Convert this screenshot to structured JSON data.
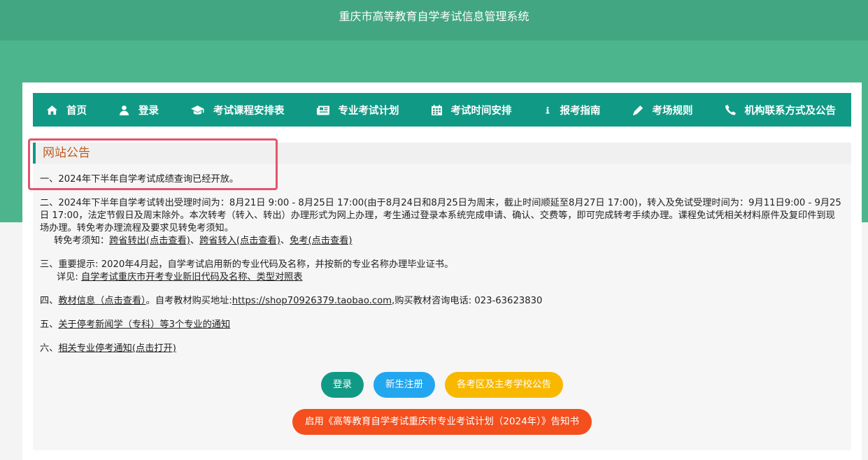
{
  "header": {
    "title": "重庆市高等教育自学考试信息管理系统"
  },
  "nav": {
    "items": [
      {
        "label": "首页",
        "icon": "home-icon"
      },
      {
        "label": "登录",
        "icon": "user-icon"
      },
      {
        "label": "考试课程安排表",
        "icon": "graduation-cap-icon"
      },
      {
        "label": "专业考试计划",
        "icon": "newspaper-icon"
      },
      {
        "label": "考试时间安排",
        "icon": "calendar-icon"
      },
      {
        "label": "报考指南",
        "icon": "info-icon"
      },
      {
        "label": "考场规则",
        "icon": "pencil-icon"
      },
      {
        "label": "机构联系方式及公告",
        "icon": "phone-icon"
      }
    ]
  },
  "notice": {
    "title": "网站公告",
    "item1": "一、2024年下半年自学考试成绩查询已经开放。",
    "item2": "二、2024年下半年自学考试转出受理时间为：8月21日 9:00 - 8月25日 17:00(由于8月24日和8月25日为周末，截止时间顺延至8月27日 17:00)，转入及免试受理时间为：9月11日9:00 - 9月25日 17:00，法定节假日及周末除外。本次转考（转入、转出）办理形式为网上办理，考生通过登录本系统完成申请、确认、交费等，即可完成转考手续办理。课程免试凭相关材料原件及复印件到现场办理。转免考办理流程及要求见转免考须知。",
    "item2_sub_label": "转免考须知：",
    "item2_links": [
      "跨省转出(点击查看)",
      "跨省转入(点击查看)",
      "免考(点击查看)"
    ],
    "item2_sep": "、",
    "item3": "三、重要提示: 2020年4月起，自学考试启用新的专业代码及名称，并按新的专业名称办理毕业证书。",
    "item3_sub_label": "详见: ",
    "item3_link": "自学考试重庆市开考专业新旧代码及名称、类型对照表",
    "item4_prefix": "四、",
    "item4_link": "教材信息（点击查看）",
    "item4_mid": "。自考教材购买地址:",
    "item4_url": "https://shop70926379.taobao.com",
    "item4_suffix": ",购买教材咨询电话:  023-63623830",
    "item5_prefix": "五、",
    "item5_link": "关于停考新闻学（专科）等3个专业的通知",
    "item6_prefix": "六、",
    "item6_link": "相关专业停考通知(点击打开)"
  },
  "buttons": {
    "login": "登录",
    "register": "新生注册",
    "announcements": "各考区及主考学校公告",
    "plan_notice": "启用《高等教育自学考试重庆市专业考试计划（2024年）》告知书"
  },
  "colors": {
    "brand": "#109a86",
    "header": "#42a683",
    "band": "#4db58d",
    "highlight": "#e2556b",
    "title_text": "#c25a1e",
    "blue": "#23a6f0",
    "yellow": "#f9b800",
    "orange": "#f44f1d"
  }
}
